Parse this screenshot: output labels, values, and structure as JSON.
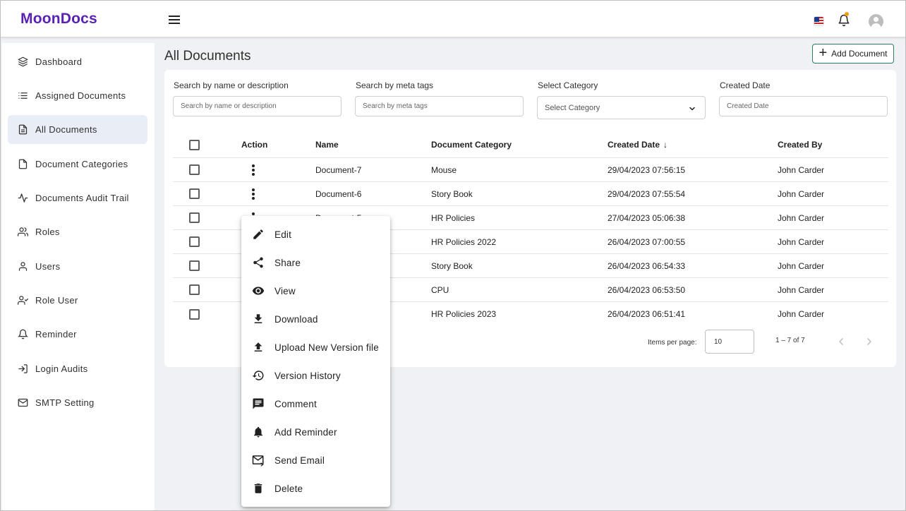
{
  "app": {
    "logo": "MoonDocs"
  },
  "sidebar": {
    "items": [
      {
        "label": "Dashboard",
        "icon": "layers-icon"
      },
      {
        "label": "Assigned Documents",
        "icon": "list-icon"
      },
      {
        "label": "All Documents",
        "icon": "document-icon",
        "active": true
      },
      {
        "label": "Document Categories",
        "icon": "document-outline-icon"
      },
      {
        "label": "Documents Audit Trail",
        "icon": "activity-icon"
      },
      {
        "label": "Roles",
        "icon": "users-icon"
      },
      {
        "label": "Users",
        "icon": "user-icon"
      },
      {
        "label": "Role User",
        "icon": "user-check-icon"
      },
      {
        "label": "Reminder",
        "icon": "bell-icon"
      },
      {
        "label": "Login Audits",
        "icon": "login-icon"
      },
      {
        "label": "SMTP Setting",
        "icon": "mail-icon"
      }
    ]
  },
  "page": {
    "title": "All Documents",
    "add_button": "Add Document"
  },
  "filters": {
    "search_name_label": "Search by name or description",
    "search_name_placeholder": "Search by name or description",
    "search_meta_label": "Search by meta tags",
    "search_meta_placeholder": "Search by meta tags",
    "category_label": "Select Category",
    "category_value": "Select Category",
    "date_label": "Created Date",
    "date_placeholder": "Created Date"
  },
  "table": {
    "columns": [
      "Action",
      "Name",
      "Document Category",
      "Created Date",
      "Created By"
    ],
    "sort_indicator": "↓",
    "rows": [
      {
        "name": "Document-7",
        "category": "Mouse",
        "created": "29/04/2023 07:56:15",
        "by": "John Carder"
      },
      {
        "name": "Document-6",
        "category": "Story Book",
        "created": "29/04/2023 07:55:54",
        "by": "John Carder"
      },
      {
        "name": "Document-5",
        "category": "HR Policies",
        "created": "27/04/2023 05:06:38",
        "by": "John Carder"
      },
      {
        "name": "",
        "category": "HR Policies 2022",
        "created": "26/04/2023 07:00:55",
        "by": "John Carder"
      },
      {
        "name": "",
        "category": "Story Book",
        "created": "26/04/2023 06:54:33",
        "by": "John Carder"
      },
      {
        "name": "",
        "category": "CPU",
        "created": "26/04/2023 06:53:50",
        "by": "John Carder"
      },
      {
        "name": "",
        "category": "HR Policies 2023",
        "created": "26/04/2023 06:51:41",
        "by": "John Carder"
      }
    ]
  },
  "paginator": {
    "items_per_page_label": "Items per page:",
    "items_per_page_value": "10",
    "range": "1 – 7 of 7"
  },
  "context_menu": {
    "items": [
      {
        "label": "Edit",
        "icon": "pencil-icon"
      },
      {
        "label": "Share",
        "icon": "share-icon"
      },
      {
        "label": "View",
        "icon": "eye-icon"
      },
      {
        "label": "Download",
        "icon": "download-icon"
      },
      {
        "label": "Upload New Version file",
        "icon": "upload-icon"
      },
      {
        "label": "Version History",
        "icon": "history-icon"
      },
      {
        "label": "Comment",
        "icon": "comment-icon"
      },
      {
        "label": "Add Reminder",
        "icon": "bell-filled-icon"
      },
      {
        "label": "Send Email",
        "icon": "send-email-icon"
      },
      {
        "label": "Delete",
        "icon": "trash-icon"
      }
    ]
  },
  "colors": {
    "brand": "#5b21b6",
    "active_nav": "#e9edf6",
    "add_button_border": "#2e7d5b",
    "notification_dot": "#f59e0b"
  }
}
